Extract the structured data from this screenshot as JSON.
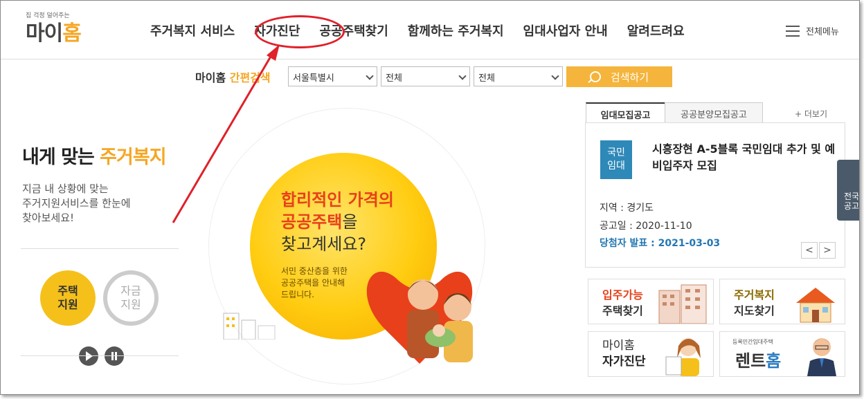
{
  "logo": {
    "tagline": "집 걱정 덜어주는",
    "name_part1": "마이",
    "name_part2": "홈"
  },
  "nav": {
    "items": [
      "주거복지 서비스",
      "자가진단",
      "공공주택찾기",
      "함께하는 주거복지",
      "임대사업자 안내",
      "알려드려요"
    ],
    "all_menu": "전체메뉴"
  },
  "quick_search": {
    "title_part1": "마이홈",
    "title_part2": "간편검색",
    "region": "서울특별시",
    "type": "전체",
    "category": "전체",
    "button": "검색하기"
  },
  "left_panel": {
    "title_part1": "내게 맞는",
    "title_part2": "주거복지",
    "desc_line1": "지금 내 상황에 맞는",
    "desc_line2": "주거지원서비스를 한눈에",
    "desc_line3": "찾아보세요!",
    "btn_housing_line1": "주택",
    "btn_housing_line2": "지원",
    "btn_fund_line1": "자금",
    "btn_fund_line2": "지원"
  },
  "visual": {
    "title_line1": "합리적인 가격의",
    "title_line2_accent": "공공주택",
    "title_line2_rest": "을",
    "title_line3": "찾고계세요?",
    "sub_line1": "서민 중산층을 위한",
    "sub_line2": "공공주택을 안내해",
    "sub_line3": "드립니다."
  },
  "notice": {
    "tab_active": "임대모집공고",
    "tab_inactive": "공공분양모집공고",
    "more": "+ 더보기",
    "badge_line1": "국민",
    "badge_line2": "임대",
    "title": "시흥장현 A-5블록 국민임대 추가 및 예비입주자 모집",
    "region": "지역 : 경기도",
    "date": "공고일 : 2020-11-10",
    "announce": "당첨자 발표 : 2021-03-03",
    "prev": "<",
    "next": ">"
  },
  "side_tab": {
    "line1": "전국",
    "line2": "공고"
  },
  "banners": {
    "b1_line1": "입주가능",
    "b1_line2": "주택찾기",
    "b2_line1": "주거복지",
    "b2_line2": "지도찾기",
    "b3_line1": "마이홈",
    "b3_line2": "자가진단",
    "b4_tiny": "등록민간임대주택",
    "b4_part1": "렌트",
    "b4_part2": "홈"
  },
  "colors": {
    "accent": "#f5a623",
    "highlight_circle": "#e0202a",
    "notice_blue": "#2e89b8"
  }
}
